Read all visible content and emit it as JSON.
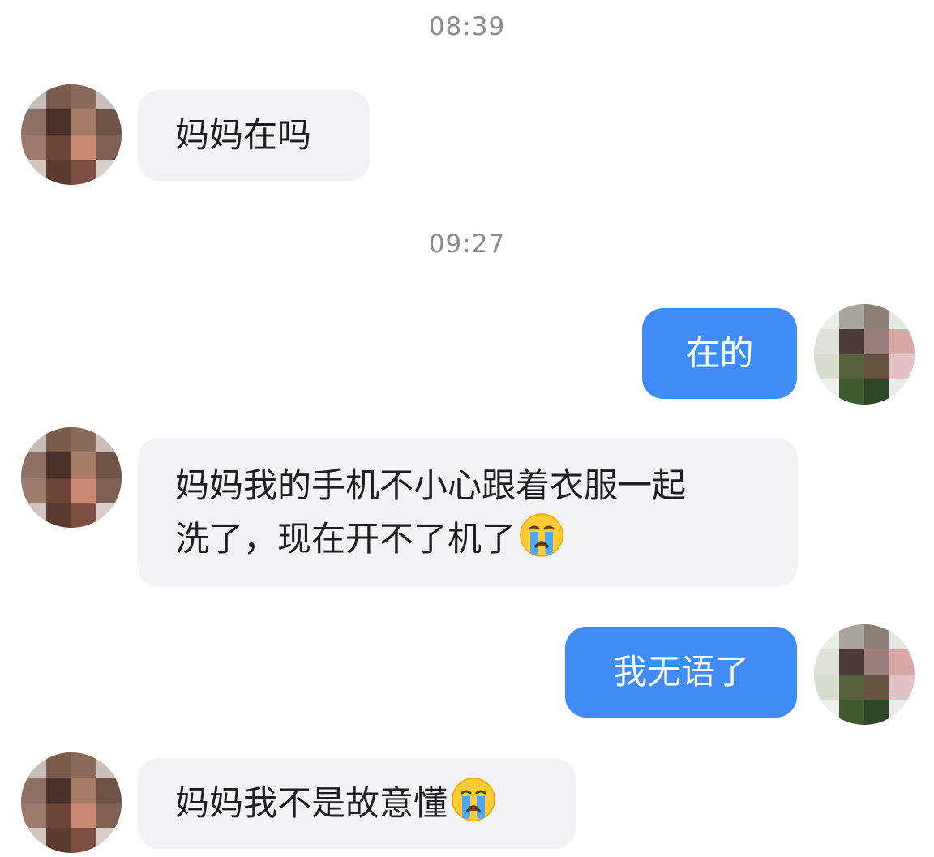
{
  "chat": {
    "timestamps": [
      "08:39",
      "09:27"
    ],
    "messages": [
      {
        "sender": "other",
        "text": "妈妈在吗"
      },
      {
        "sender": "me",
        "text": "在的"
      },
      {
        "sender": "other",
        "line1": "妈妈我的手机不小心跟着衣服一起",
        "line2": "洗了，现在开不了机了",
        "emoji": "crying-face-icon"
      },
      {
        "sender": "me",
        "text": "我无语了"
      },
      {
        "sender": "other",
        "text": "妈妈我不是故意懂",
        "emoji": "crying-face-icon"
      }
    ]
  },
  "colors": {
    "outgoing_bubble": "#3f8cf7",
    "incoming_bubble": "#f3f3f5",
    "timestamp_text": "#8c8c8c",
    "background": "#ffffff"
  }
}
